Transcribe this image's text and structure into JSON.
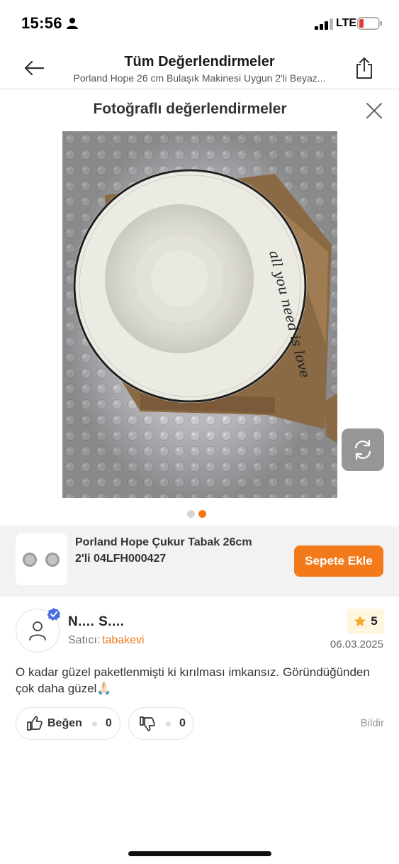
{
  "status_bar": {
    "time": "15:56",
    "network": "LTE",
    "battery_color": "#e53935"
  },
  "header": {
    "title": "Tüm Değerlendirmeler",
    "subtitle": "Porland Hope 26 cm Bulaşık Makinesi Uygun 2'li Beyaz..."
  },
  "gallery": {
    "title": "Fotoğraflı değerlendirmeler",
    "plate_text": "all you need is love",
    "current_index": 2,
    "total": 2,
    "accent": "#f27a1a"
  },
  "product": {
    "name_line1": "Porland Hope Çukur Tabak 26cm",
    "name_line2": "2'li 04LFH000427",
    "add_to_cart": "Sepete Ekle"
  },
  "review": {
    "reviewer": "N.... S....",
    "seller_label": "Satıcı:",
    "seller": "tabakevi",
    "rating": "5",
    "date": "06.03.2025",
    "text": "O kadar güzel paketlenmişti ki kırılması imkansız. Göründüğünden çok daha güzel🙏🏻",
    "like_label": "Beğen",
    "like_count": "0",
    "dislike_count": "0",
    "report": "Bildir"
  }
}
